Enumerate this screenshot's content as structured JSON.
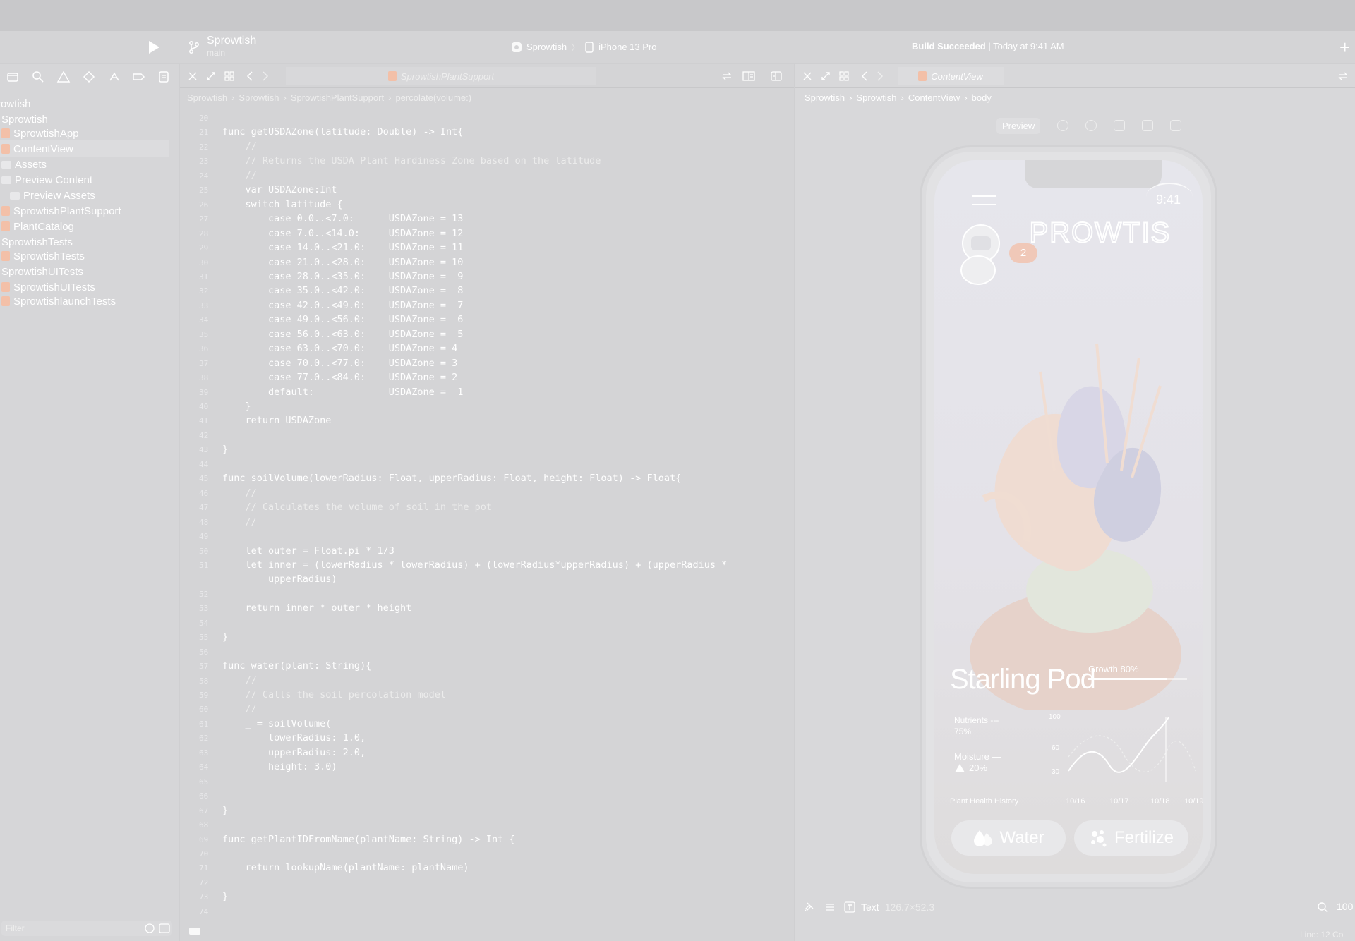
{
  "toolbar": {
    "project": "Sprowtish",
    "branch": "main",
    "scheme_target": "Sprowtish",
    "scheme_device": "iPhone 13 Pro",
    "build_status_bold": "Build Succeeded",
    "build_status_time": " | Today at 9:41 AM",
    "add_label": "+"
  },
  "navigator": {
    "items": [
      {
        "label": "rowtish",
        "indent": 0,
        "icon": "none"
      },
      {
        "label": "Sprowtish",
        "indent": 1,
        "icon": "none"
      },
      {
        "label": "SprowtishApp",
        "indent": 1,
        "icon": "swift"
      },
      {
        "label": "ContentView",
        "indent": 1,
        "icon": "swift",
        "selected": true
      },
      {
        "label": "Assets",
        "indent": 1,
        "icon": "folder"
      },
      {
        "label": "Preview Content",
        "indent": 1,
        "icon": "folder"
      },
      {
        "label": "Preview Assets",
        "indent": 2,
        "icon": "folder"
      },
      {
        "label": "SprowtishPlantSupport",
        "indent": 1,
        "icon": "swift"
      },
      {
        "label": "PlantCatalog",
        "indent": 1,
        "icon": "swift"
      },
      {
        "label": "SprowtishTests",
        "indent": 1,
        "icon": "none"
      },
      {
        "label": "SprowtishTests",
        "indent": 1,
        "icon": "swift"
      },
      {
        "label": "SprowtishUITests",
        "indent": 1,
        "icon": "none"
      },
      {
        "label": "SprowtishUITests",
        "indent": 1,
        "icon": "swift"
      },
      {
        "label": "SprowtishlaunchTests",
        "indent": 1,
        "icon": "swift"
      }
    ],
    "filter_placeholder": "Filter"
  },
  "editor": {
    "tab": "SprowtishPlantSupport",
    "jumpbar": [
      "Sprowtish",
      "Sprowtish",
      "SprowtishPlantSupport",
      "percolate(volume:)"
    ],
    "lines": [
      {
        "n": "20",
        "t": ""
      },
      {
        "n": "21",
        "t": "func getUSDAZone(latitude: Double) -> Int{"
      },
      {
        "n": "22",
        "t": "    //",
        "c": true
      },
      {
        "n": "23",
        "t": "    // Returns the USDA Plant Hardiness Zone based on the latitude",
        "c": true
      },
      {
        "n": "24",
        "t": "    //",
        "c": true
      },
      {
        "n": "25",
        "t": "    var USDAZone:Int"
      },
      {
        "n": "26",
        "t": "    switch latitude {"
      },
      {
        "n": "27",
        "t": "        case 0.0..<7.0:      USDAZone = 13"
      },
      {
        "n": "28",
        "t": "        case 7.0..<14.0:     USDAZone = 12"
      },
      {
        "n": "29",
        "t": "        case 14.0..<21.0:    USDAZone = 11"
      },
      {
        "n": "30",
        "t": "        case 21.0..<28.0:    USDAZone = 10"
      },
      {
        "n": "31",
        "t": "        case 28.0..<35.0:    USDAZone =  9"
      },
      {
        "n": "32",
        "t": "        case 35.0..<42.0:    USDAZone =  8"
      },
      {
        "n": "33",
        "t": "        case 42.0..<49.0:    USDAZone =  7"
      },
      {
        "n": "34",
        "t": "        case 49.0..<56.0:    USDAZone =  6"
      },
      {
        "n": "35",
        "t": "        case 56.0..<63.0:    USDAZone =  5"
      },
      {
        "n": "36",
        "t": "        case 63.0..<70.0:    USDAZone = 4"
      },
      {
        "n": "37",
        "t": "        case 70.0..<77.0:    USDAZone = 3"
      },
      {
        "n": "38",
        "t": "        case 77.0..<84.0:    USDAZone = 2"
      },
      {
        "n": "39",
        "t": "        default:             USDAZone =  1"
      },
      {
        "n": "40",
        "t": "    }"
      },
      {
        "n": "41",
        "t": "    return USDAZone"
      },
      {
        "n": "42",
        "t": ""
      },
      {
        "n": "43",
        "t": "}"
      },
      {
        "n": "44",
        "t": ""
      },
      {
        "n": "45",
        "t": "func soilVolume(lowerRadius: Float, upperRadius: Float, height: Float) -> Float{"
      },
      {
        "n": "46",
        "t": "    //",
        "c": true
      },
      {
        "n": "47",
        "t": "    // Calculates the volume of soil in the pot",
        "c": true
      },
      {
        "n": "48",
        "t": "    //",
        "c": true
      },
      {
        "n": "49",
        "t": ""
      },
      {
        "n": "50",
        "t": "    let outer = Float.pi * 1/3"
      },
      {
        "n": "51",
        "t": "    let inner = (lowerRadius * lowerRadius) + (lowerRadius*upperRadius) + (upperRadius *"
      },
      {
        "n": "",
        "t": "        upperRadius)"
      },
      {
        "n": "52",
        "t": ""
      },
      {
        "n": "53",
        "t": "    return inner * outer * height"
      },
      {
        "n": "54",
        "t": ""
      },
      {
        "n": "55",
        "t": "}"
      },
      {
        "n": "56",
        "t": ""
      },
      {
        "n": "57",
        "t": "func water(plant: String){"
      },
      {
        "n": "58",
        "t": "    //",
        "c": true
      },
      {
        "n": "59",
        "t": "    // Calls the soil percolation model",
        "c": true
      },
      {
        "n": "60",
        "t": "    //",
        "c": true
      },
      {
        "n": "61",
        "t": "    _ = soilVolume("
      },
      {
        "n": "62",
        "t": "        lowerRadius: 1.0,"
      },
      {
        "n": "63",
        "t": "        upperRadius: 2.0,"
      },
      {
        "n": "64",
        "t": "        height: 3.0)"
      },
      {
        "n": "65",
        "t": ""
      },
      {
        "n": "66",
        "t": ""
      },
      {
        "n": "67",
        "t": "}"
      },
      {
        "n": "68",
        "t": ""
      },
      {
        "n": "69",
        "t": "func getPlantIDFromName(plantName: String) -> Int {"
      },
      {
        "n": "70",
        "t": ""
      },
      {
        "n": "71",
        "t": "    return lookupName(plantName: plantName)"
      },
      {
        "n": "72",
        "t": ""
      },
      {
        "n": "73",
        "t": "}"
      },
      {
        "n": "74",
        "t": ""
      }
    ]
  },
  "canvas": {
    "tab": "ContentView",
    "jumpbar": [
      "Sprowtish",
      "Sprowtish",
      "ContentView",
      "body"
    ],
    "preview_label": "Preview",
    "inspect_type": "Text",
    "inspect_size": "126.7×52.3",
    "zoom": "100",
    "line_col": "Line: 12  Co"
  },
  "app": {
    "time": "9:41",
    "badge": "2",
    "plant_name": "Starling Pod",
    "growth_label": "Growth 80%",
    "growth": 0.8,
    "nutrients_label": "Nutrients ---",
    "nutrients_value": "75%",
    "moisture_label": "Moisture —",
    "moisture_value": "20%",
    "chart_ticks": [
      "100",
      "60",
      "30"
    ],
    "chart_title": "Plant Health History",
    "dates": [
      "10/16",
      "10/17",
      "10/18",
      "10/19"
    ],
    "water_label": "Water",
    "fertilize_label": "Fertilize"
  },
  "colors": {
    "background": "#cfcfd1",
    "accent_peach": "#f3c0a8",
    "text": "#ffffff"
  }
}
